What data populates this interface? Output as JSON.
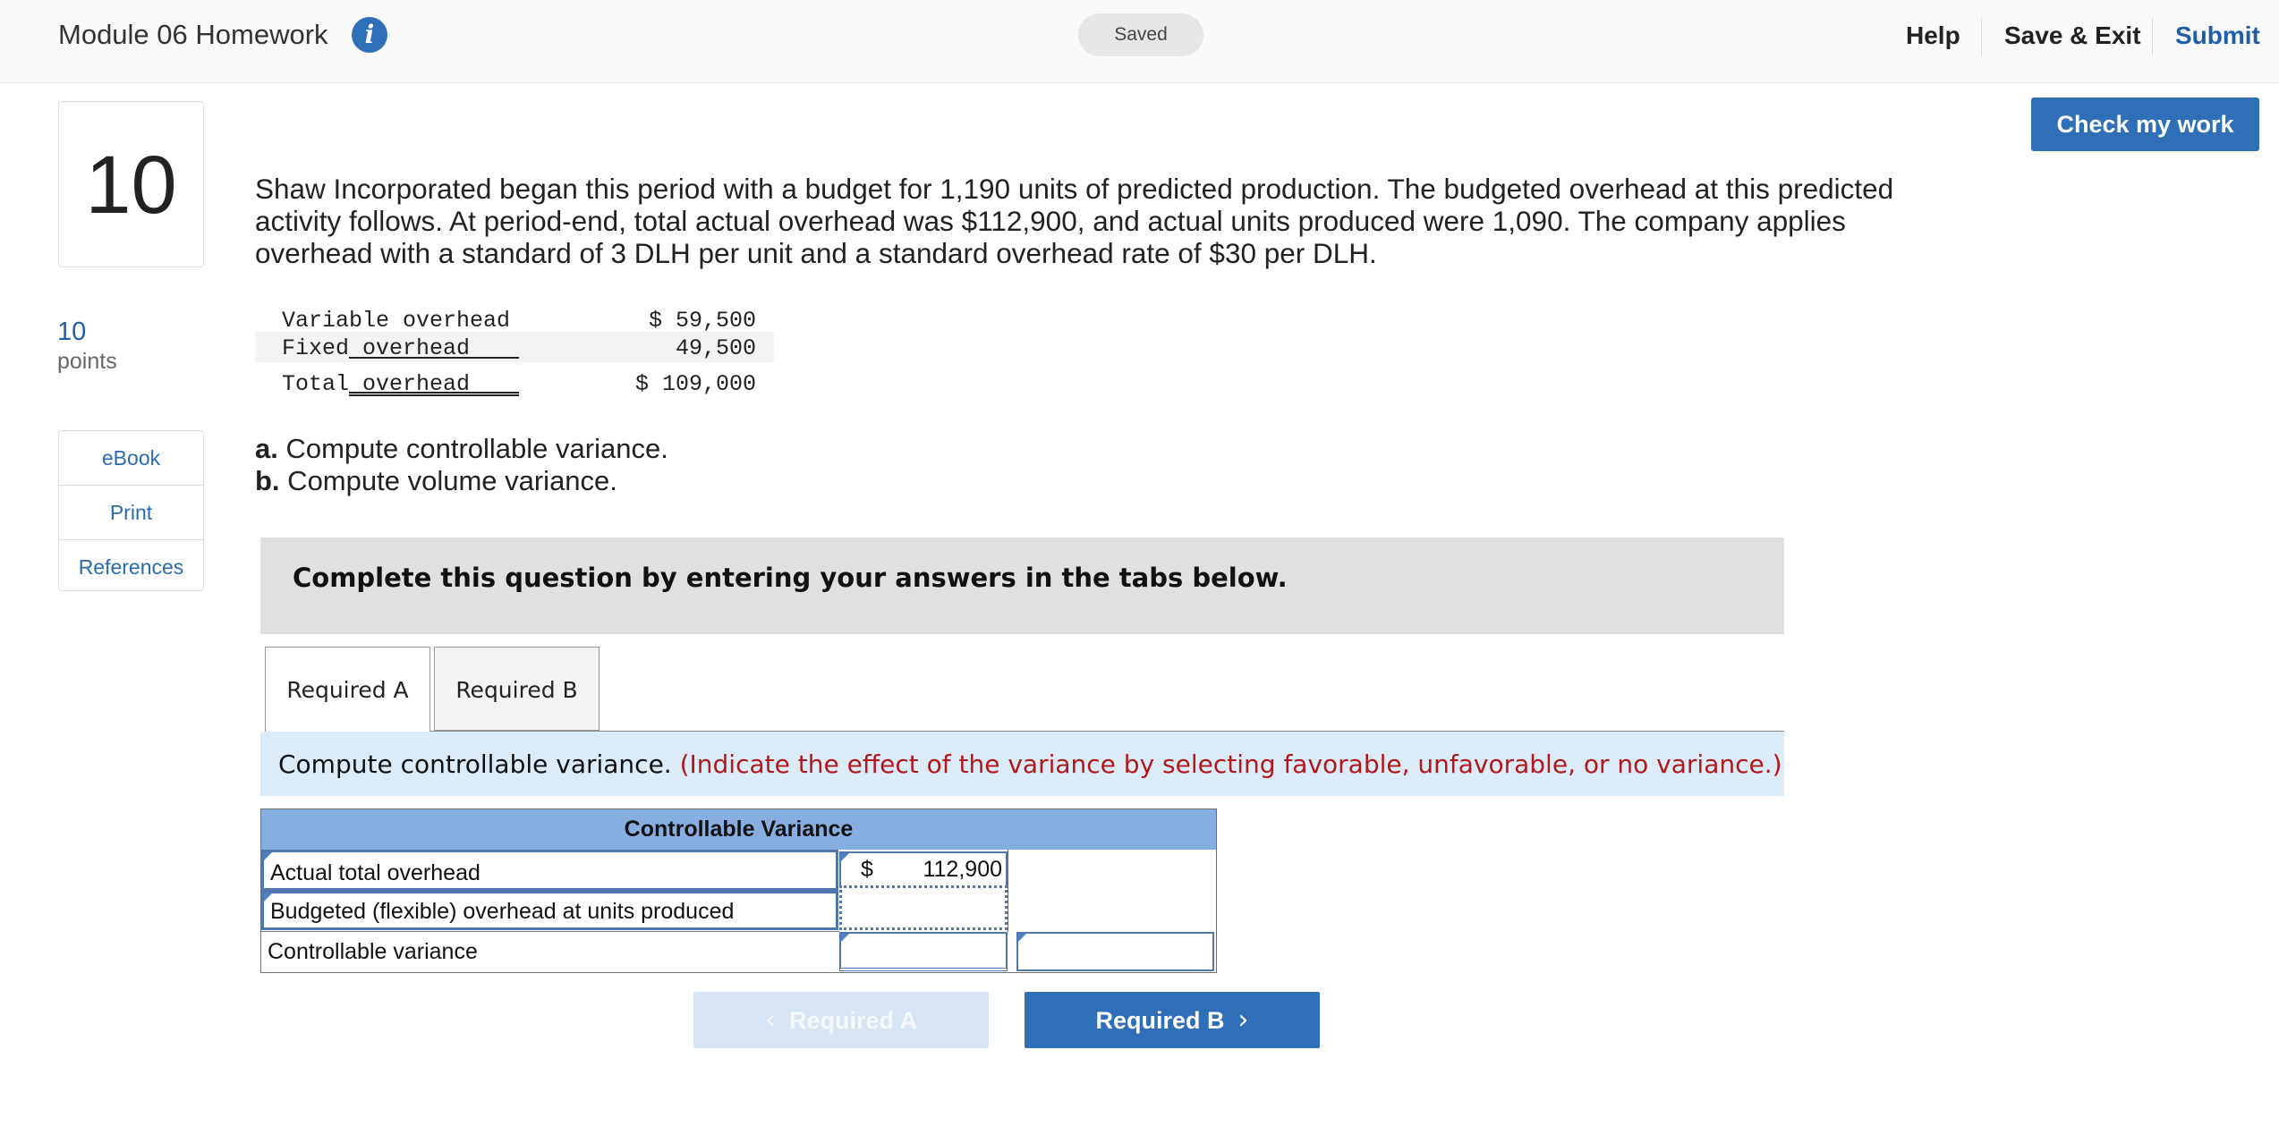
{
  "header": {
    "title": "Module 06 Homework",
    "info_icon": "i",
    "saved": "Saved",
    "help": "Help",
    "save_exit": "Save & Exit",
    "submit": "Submit"
  },
  "check_my_work": "Check my work",
  "question": {
    "number": "10",
    "points_value": "10",
    "points_label": "points"
  },
  "side_links": [
    "eBook",
    "Print",
    "References"
  ],
  "problem_text": "Shaw Incorporated began this period with a budget for 1,190 units of predicted production. The budgeted overhead at this predicted activity follows. At period-end, total actual overhead was $112,900, and actual units produced were 1,090. The company applies overhead with a standard of 3 DLH per unit and a standard overhead rate of $30 per DLH.",
  "overhead_table": [
    {
      "label": "Variable overhead",
      "value": "$ 59,500"
    },
    {
      "label": "Fixed overhead",
      "value": "49,500"
    },
    {
      "label": "Total overhead",
      "value": "$ 109,000"
    }
  ],
  "parts": {
    "a_letter": "a.",
    "a_text": " Compute controllable variance.",
    "b_letter": "b.",
    "b_text": " Compute volume variance."
  },
  "instruction": "Complete this question by entering your answers in the tabs below.",
  "tabs": [
    {
      "label": "Required A",
      "active": true
    },
    {
      "label": "Required B",
      "active": false
    }
  ],
  "prompt": {
    "main": "Compute controllable variance. ",
    "hint": "(Indicate the effect of the variance by selecting favorable, unfavorable, or no variance.)"
  },
  "variance_table": {
    "header": "Controllable Variance",
    "rows": [
      {
        "label": "Actual total overhead",
        "currency": "$",
        "amount": "112,900",
        "effect": ""
      },
      {
        "label": "Budgeted (flexible) overhead at units produced",
        "currency": "",
        "amount": "",
        "effect": ""
      },
      {
        "label": "Controllable variance",
        "currency": "",
        "amount": "",
        "effect": ""
      }
    ]
  },
  "nav": {
    "prev": "Required A",
    "next": "Required B",
    "prev_enabled": false
  },
  "colors": {
    "brand_blue": "#2f6fb7",
    "table_header": "#86aee0",
    "prompt_bg": "#dcebf8",
    "hint_red": "#b2181b"
  }
}
